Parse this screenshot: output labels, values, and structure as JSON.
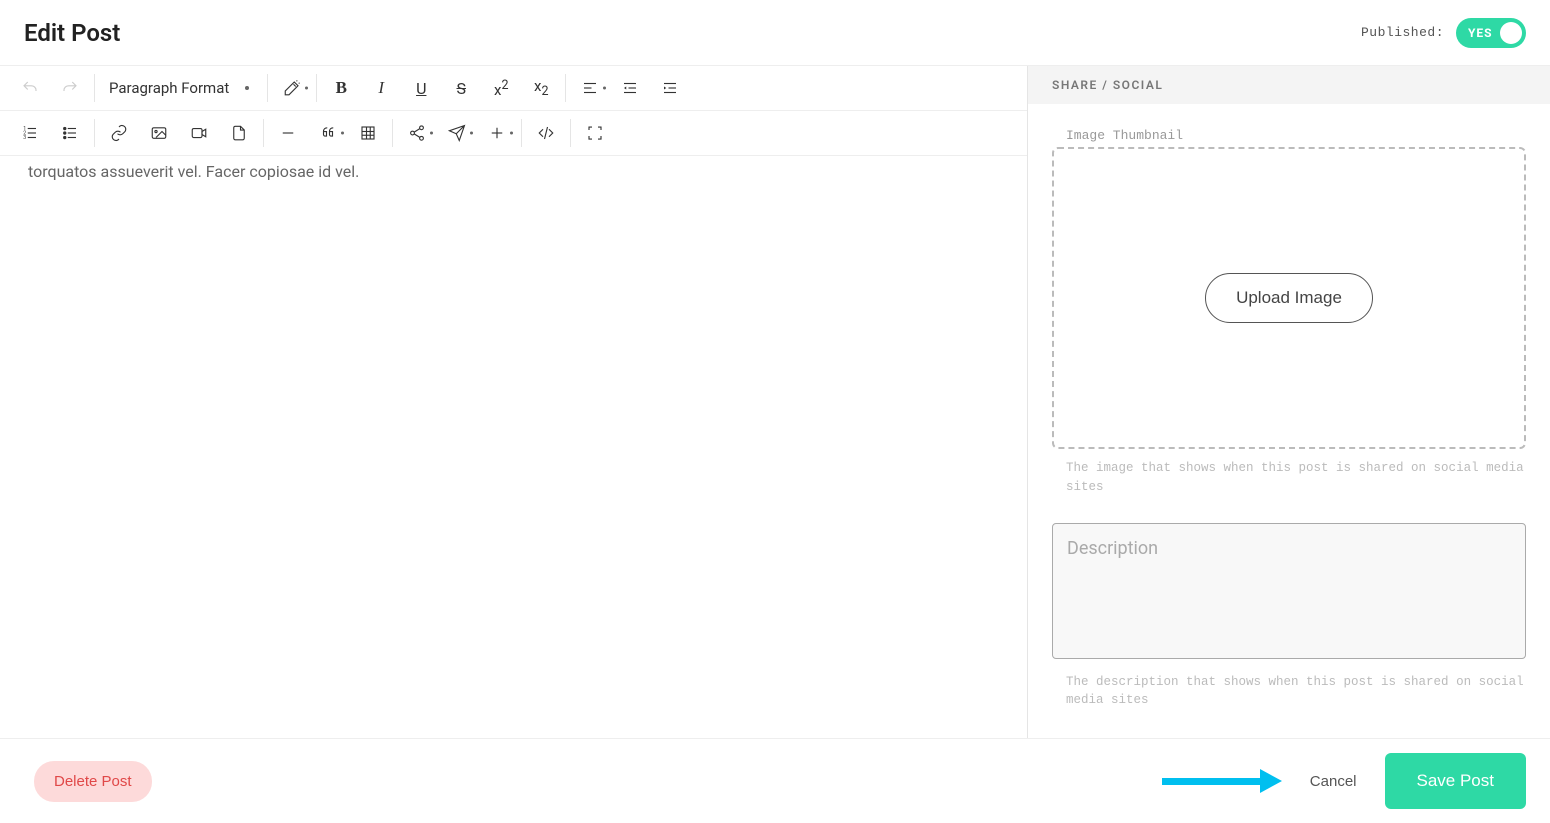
{
  "header": {
    "title": "Edit Post",
    "published_label": "Published:",
    "toggle_text": "YES"
  },
  "toolbar": {
    "paragraph_format": "Paragraph Format"
  },
  "editor": {
    "content_fragment": "torquatos assueverit vel. Facer copiosae id vel."
  },
  "sidebar": {
    "header": "SHARE / SOCIAL",
    "thumb_label": "Image Thumbnail",
    "upload_button": "Upload Image",
    "thumb_helper": "The image that shows when this post is shared on social media sites",
    "desc_placeholder": "Description",
    "desc_helper": "The description that shows when this post is shared on social media sites"
  },
  "footer": {
    "delete": "Delete Post",
    "cancel": "Cancel",
    "save": "Save Post"
  }
}
